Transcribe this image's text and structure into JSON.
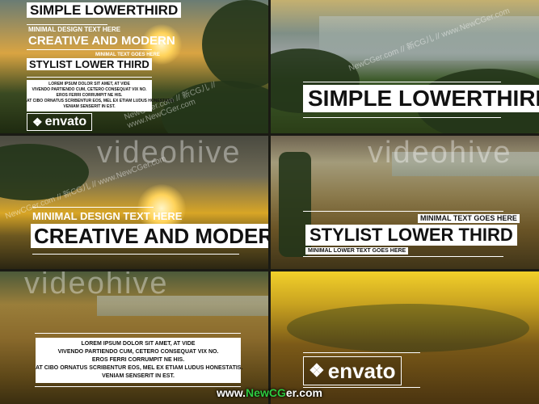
{
  "panel1": {
    "title": "SIMPLE LOWERTHIRD",
    "small_heading": "MINIMAL DESIGN TEXT HERE",
    "heading": "CREATIVE AND MODERN",
    "tiny_label": "MINIMAL TEXT GOES HERE",
    "sub_heading": "STYLIST LOWER THIRD",
    "body_lines": [
      "LOREM IPSUM DOLOR SIT AMET, AT VIDE",
      "VIVENDO PARTIENDO CUM, CETERO CONSEQUAT VIX NO.",
      "EROS FERRI CORRUMPIT NE HIS.",
      "AT CIBO ORNATUS SCRIBENTUR EOS, MEL EX ETIAM LUDUS HONESTATIS.",
      "VENIAM SENSERIT IN EST."
    ],
    "logo": "envato"
  },
  "panel2": {
    "title": "SIMPLE LOWERTHIRD"
  },
  "panel3": {
    "watermark": "videohive",
    "small_heading": "MINIMAL DESIGN TEXT HERE",
    "heading": "CREATIVE AND MODERN"
  },
  "panel4": {
    "watermark": "videohive",
    "top_label": "MINIMAL TEXT GOES HERE",
    "heading": "STYLIST LOWER THIRD",
    "bottom_label": "MINIMAL LOWER TEXT GOES HERE"
  },
  "panel5": {
    "watermark": "videohive",
    "body_lines": [
      "LOREM IPSUM DOLOR SIT AMET, AT VIDE",
      "VIVENDO PARTIENDO CUM, CETERO CONSEQUAT VIX NO.",
      "EROS FERRI CORRUMPIT NE HIS.",
      "AT CIBO ORNATUS SCRIBENTUR EOS, MEL EX ETIAM LUDUS HONESTATIS.",
      "VENIAM SENSERIT IN EST."
    ]
  },
  "panel6": {
    "logo": "envato"
  },
  "watermark_site": "NewCGer.com // 新CG儿 // www.NewCGer.com",
  "footer": {
    "prefix": "www.",
    "highlight": "NewCG",
    "suffix": "er.com"
  },
  "colors": {
    "lower_third_bg": "#ffffff",
    "footer_highlight": "#2ecc40"
  }
}
